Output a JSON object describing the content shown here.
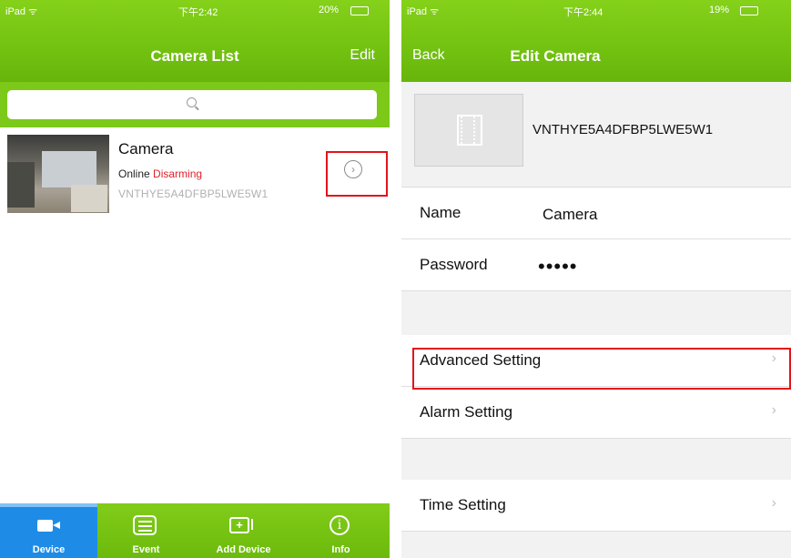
{
  "left_screen": {
    "status": {
      "carrier": "iPad ᯤ",
      "time": "下午2:42",
      "battery": "20%"
    },
    "nav": {
      "title": "Camera List",
      "edit": "Edit"
    },
    "search": {
      "placeholder": ""
    },
    "camera": {
      "name": "Camera",
      "online": "Online",
      "state": "Disarming",
      "uid": "VNTHYE5A4DFBP5LWE5W1"
    },
    "detail_glyph": "›",
    "tabs": [
      {
        "label": "Device",
        "icon": "camera-icon",
        "selected": true
      },
      {
        "label": "Event",
        "icon": "list-icon",
        "selected": false
      },
      {
        "label": "Add Device",
        "icon": "add-device-icon",
        "selected": false
      },
      {
        "label": "Info",
        "icon": "info-icon",
        "selected": false
      }
    ],
    "info_glyph": "i",
    "add_glyph": "+"
  },
  "right_screen": {
    "status": {
      "carrier": "iPad ᯤ",
      "time": "下午2:44",
      "battery": "19%"
    },
    "nav": {
      "back": "Back",
      "title": "Edit Camera"
    },
    "uid": "VNTHYE5A4DFBP5LWE5W1",
    "fields": {
      "name_label": "Name",
      "name_value": "Camera",
      "password_label": "Password",
      "password_value": "•••••"
    },
    "menu": [
      {
        "label": "Advanced Setting"
      },
      {
        "label": "Alarm Setting"
      },
      {
        "label": "Time Setting"
      }
    ],
    "chevron": "›"
  },
  "colors": {
    "nav_green": "#74c312",
    "tab_selected": "#1e8ce6",
    "highlight": "#e2141c",
    "state_red": "#e0202a"
  }
}
